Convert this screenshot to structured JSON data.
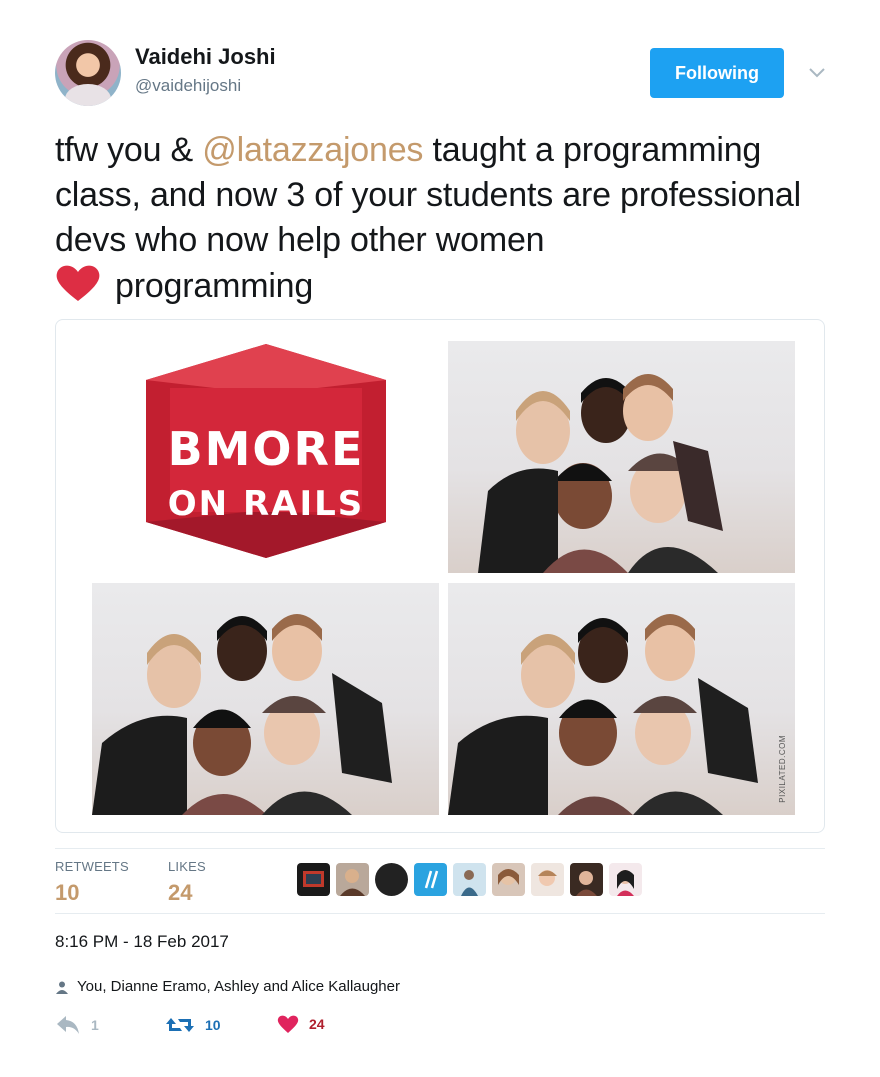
{
  "author": {
    "name": "Vaidehi Joshi",
    "handle": "@vaidehijoshi"
  },
  "follow_button": "Following",
  "tweet": {
    "before_mention": "tfw you & ",
    "mention": "@latazzajones",
    "after_mention": " taught a programming class, and now 3 of your students are professional devs who now help other women",
    "after_heart": "programming"
  },
  "media": {
    "logo_line1": "BMORE",
    "logo_line2": "ON RAILS",
    "watermark": "PIXILATED.COM"
  },
  "stats": {
    "retweets_label": "RETWEETS",
    "retweets_value": "10",
    "likes_label": "LIKES",
    "likes_value": "24"
  },
  "timestamp": "8:16 PM - 18 Feb 2017",
  "social_context": "You, Dianne Eramo, Ashley and Alice Kallaugher",
  "actions": {
    "reply_count": "1",
    "retweet_count": "10",
    "like_count": "24"
  },
  "colors": {
    "accent": "#c49a6c",
    "follow": "#1da1f2",
    "retweet": "#1b6fb4",
    "like": "#e0245e",
    "logo_red": "#d3273a"
  }
}
